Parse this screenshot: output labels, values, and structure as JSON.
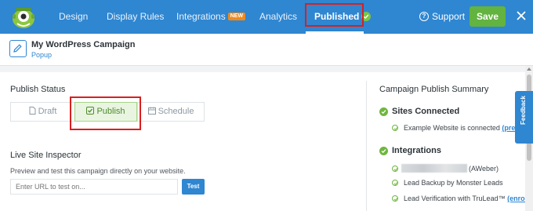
{
  "nav": {
    "items": [
      {
        "label": "Design"
      },
      {
        "label": "Display Rules"
      },
      {
        "label": "Integrations",
        "badge": "NEW"
      },
      {
        "label": "Analytics"
      },
      {
        "label": "Published"
      }
    ],
    "support_label": "Support",
    "save_label": "Save"
  },
  "campaign": {
    "title": "My WordPress Campaign",
    "type": "Popup"
  },
  "publish_status": {
    "heading": "Publish Status",
    "options": [
      {
        "label": "Draft",
        "icon": "document-icon"
      },
      {
        "label": "Publish",
        "icon": "check-square-icon",
        "selected": true
      },
      {
        "label": "Schedule",
        "icon": "calendar-icon"
      }
    ]
  },
  "inspector": {
    "heading": "Live Site Inspector",
    "description": "Preview and test this campaign directly on your website.",
    "placeholder": "Enter URL to test on...",
    "test_label": "Test"
  },
  "summary": {
    "heading": "Campaign Publish Summary",
    "sites": {
      "heading": "Sites Connected",
      "item_text": "Example Website is connected",
      "item_link": "(previ"
    },
    "integrations": {
      "heading": "Integrations",
      "items": [
        {
          "text": "(AWeber)"
        },
        {
          "text": "Lead Backup by Monster Leads"
        },
        {
          "text": "Lead Verification with TruLead™",
          "link": "(enroll)"
        }
      ]
    }
  },
  "feedback_label": "Feedback",
  "colors": {
    "brand_blue": "#2f86d1",
    "save_green": "#62b33f",
    "status_green": "#6fb63f",
    "new_badge": "#f08a1c",
    "highlight_red": "#d9201f"
  }
}
